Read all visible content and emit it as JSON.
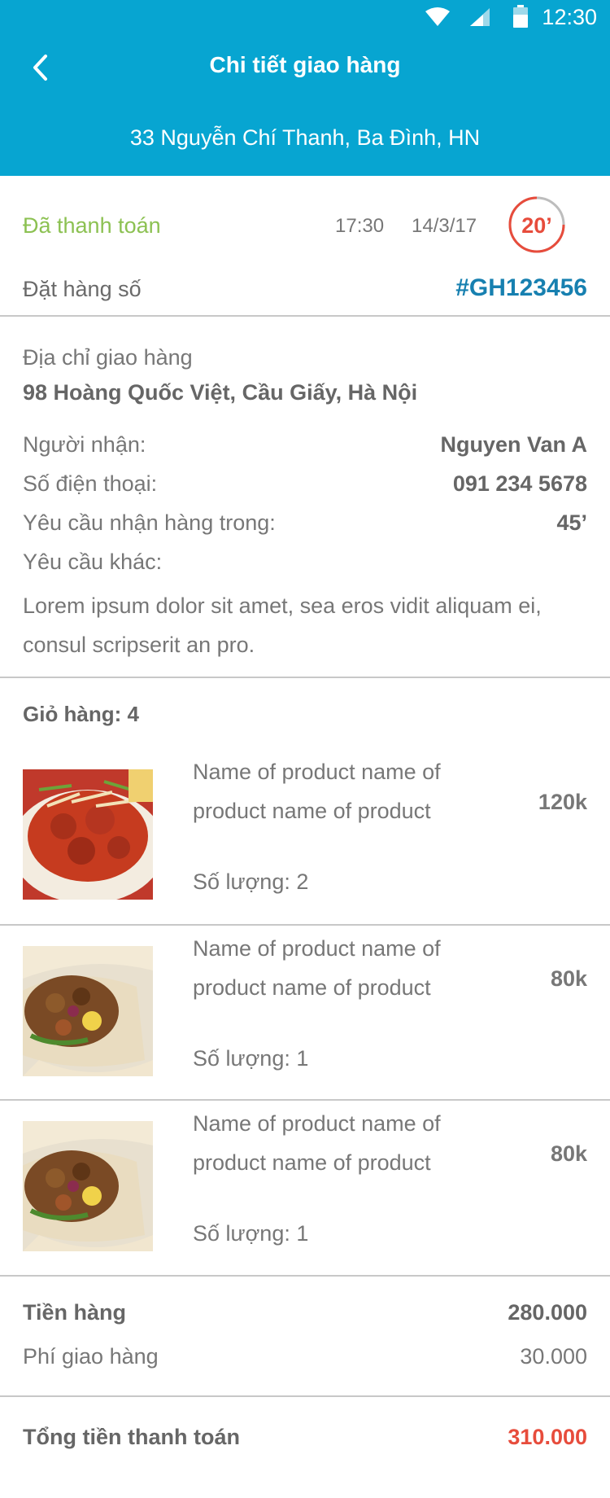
{
  "status_bar": {
    "time": "12:30"
  },
  "header": {
    "title": "Chi tiết giao hàng",
    "address": "33 Nguyễn Chí Thanh, Ba Đình, HN"
  },
  "order": {
    "payment_status": "Đã thanh toán",
    "time": "17:30",
    "date": "14/3/17",
    "timer": "20’",
    "order_number_label": "Đặt hàng số",
    "order_number": "#GH123456"
  },
  "delivery": {
    "address_label": "Địa chỉ giao hàng",
    "address": "98 Hoàng Quốc Việt, Cầu Giấy, Hà Nội",
    "recipient_label": "Người nhận:",
    "recipient": "Nguyen Van A",
    "phone_label": "Số điện thoại:",
    "phone": "091 234 5678",
    "time_required_label": "Yêu cầu nhận hàng trong:",
    "time_required": "45’",
    "other_label": "Yêu cầu khác:",
    "other_note": "Lorem ipsum dolor sit amet, sea eros vidit aliquam ei, consul scripserit an pro."
  },
  "cart": {
    "title": "Giỏ hàng: 4",
    "items": [
      {
        "name": "Name of product name of product name of product",
        "qty": "Số lượng: 2",
        "price": "120k",
        "image": "curry-dish-image"
      },
      {
        "name": "Name of product name of product name of product",
        "qty": "Số lượng: 1",
        "price": "80k",
        "image": "burrito-wrap-image"
      },
      {
        "name": "Name of product name of product name of product",
        "qty": "Số lượng: 1",
        "price": "80k",
        "image": "burrito-wrap-image"
      }
    ]
  },
  "totals": {
    "subtotal_label": "Tiền hàng",
    "subtotal": "280.000",
    "shipping_label": "Phí giao hàng",
    "shipping": "30.000",
    "grand_total_label": "Tổng tiền thanh toán",
    "grand_total": "310.000"
  },
  "colors": {
    "header_bg": "#07a5d1",
    "paid_green": "#8cc152",
    "order_blue": "#1780b0",
    "accent_red": "#e74c3c"
  }
}
